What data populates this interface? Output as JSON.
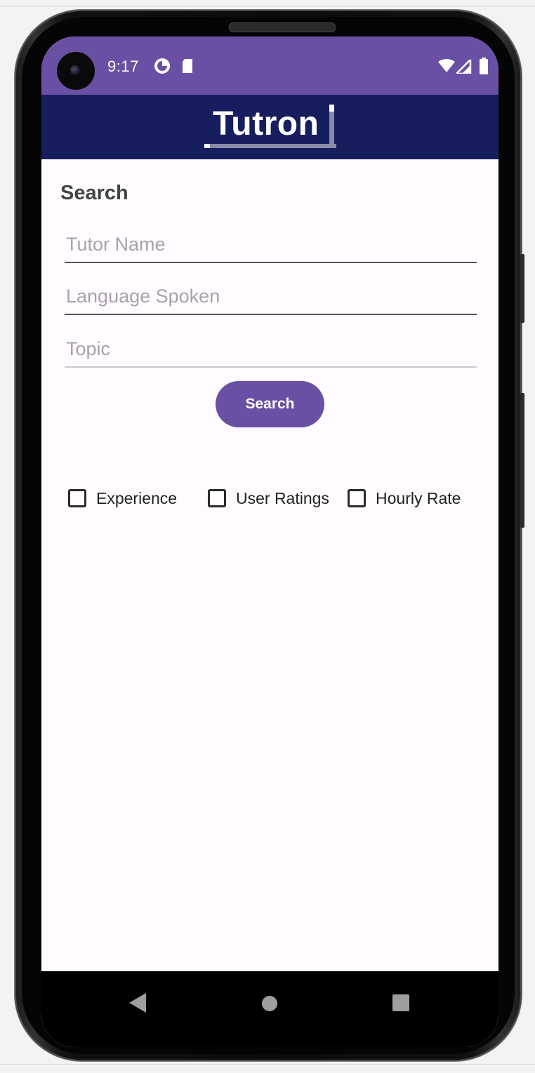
{
  "status_bar": {
    "time": "9:17",
    "left_icons": [
      "data-saver-icon",
      "sd-card-icon"
    ],
    "right_icons": [
      "wifi-icon",
      "signal-icon",
      "battery-icon"
    ]
  },
  "app_bar": {
    "logo_text": "Tutron"
  },
  "search_section": {
    "title": "Search",
    "tutor_name_placeholder": "Tutor Name",
    "language_placeholder": "Language Spoken",
    "topic_placeholder": "Topic",
    "search_button_label": "Search"
  },
  "filters": [
    {
      "label": "Experience",
      "checked": false
    },
    {
      "label": "User Ratings",
      "checked": false
    },
    {
      "label": "Hourly Rate",
      "checked": false
    }
  ],
  "colors": {
    "primary": "#6a50a4",
    "app_bar": "#171e5e",
    "background": "#fffbfe"
  }
}
